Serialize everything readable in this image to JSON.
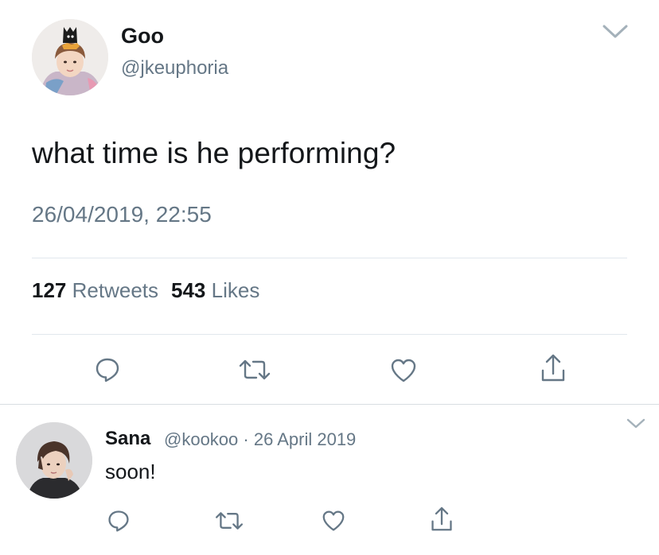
{
  "main_tweet": {
    "author_name": "Goo",
    "author_handle": "@jkeuphoria",
    "text": "what time is he performing?",
    "timestamp": "26/04/2019, 22:55",
    "retweet_count": "127",
    "retweet_label": "Retweets",
    "like_count": "543",
    "like_label": "Likes",
    "actions": [
      "reply-icon",
      "retweet-icon",
      "like-icon",
      "share-icon"
    ]
  },
  "reply": {
    "author_name": "Sana",
    "author_handle": "@kookoo",
    "separator": "·",
    "date": "26 April 2019",
    "text": "soon!",
    "actions": [
      "reply-icon",
      "retweet-icon",
      "like-icon",
      "share-icon"
    ]
  },
  "colors": {
    "text_primary": "#14171a",
    "text_secondary": "#657786",
    "divider": "#e1e8ed"
  }
}
